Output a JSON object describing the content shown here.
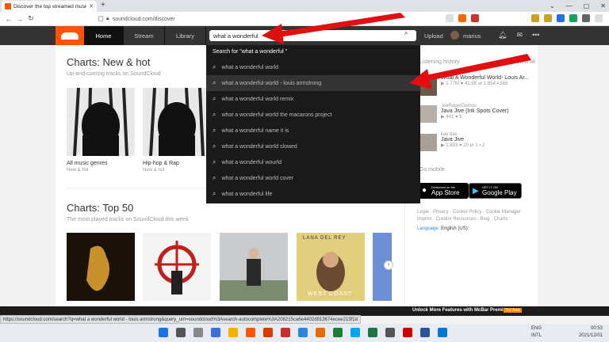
{
  "browser": {
    "tab_title": "Discover the top streamed music",
    "url": "soundcloud.com/discover",
    "status_url": "https://soundcloud.com/search?q=what a wonderful world - louis armstrong&query_urn=soundcloud%3Asearch-autocomplete%3A208215ca6e4402d913674ecee213f1d"
  },
  "header": {
    "nav": [
      "Home",
      "Stream",
      "Library"
    ],
    "search_value": "what a wonderful",
    "upload": "Upload",
    "username": "marius"
  },
  "charts_new": {
    "title": "Charts: New & hot",
    "subtitle": "Up-and-coming tracks on SoundCloud",
    "tiles": [
      {
        "label": "All music genres",
        "sub": "New & hot"
      },
      {
        "label": "Hip-hop & Rap",
        "sub": "New & hot"
      }
    ]
  },
  "charts_top": {
    "title": "Charts: Top 50",
    "subtitle": "The most played tracks on SoundCloud this week",
    "album_text": "LANA DEL REY",
    "album_text2": "WEST COAST"
  },
  "dropdown": {
    "header": "Search for \"what a wonderful \"",
    "items": [
      "what a wonderful world",
      "what a wonderful world - louis armstrong",
      "what a wonderful world remix",
      "what a wonderful world the macarons project",
      "what a wonderful name it is",
      "what a wonderful world slowed",
      "what a wonderful wourld",
      "what a wonderful world cover",
      "what a wonderful life"
    ]
  },
  "sidebar": {
    "history_label": "Listening history",
    "view_all": "View all",
    "tracks": [
      {
        "user": "",
        "title": "What A Wonderful World- Louis Ar...",
        "stats": "▶ 1.77M  ♥ 41.5K  ⇄ 1,854  ▪ 569"
      },
      {
        "user": "JoeRaperDemos",
        "title": "Java Jive (Ink Spots Cover)",
        "stats": "▶ 441  ♥ 5"
      },
      {
        "user": "kay das",
        "title": "Java Jive",
        "stats": "▶ 2,893  ♥ 20  ⇄ 1  ▪ 2"
      }
    ],
    "mobile_label": "Go mobile",
    "app_store": {
      "small": "Download on the",
      "big": "App Store"
    },
    "google_play": {
      "small": "GET IT ON",
      "big": "Google Play"
    },
    "legal": "Legal · Privacy · Cookie Policy · Cookie Manager · Imprint · Creator Resources · Blog · Charts ·",
    "language_label": "Language:",
    "language_value": "English (US)"
  },
  "mcbar": {
    "promo": "Unlock More Features with McBar Premium",
    "try": "Try free"
  },
  "taskbar": {
    "lang1": "ENG",
    "lang2": "INTL",
    "time": "00:53",
    "date": "2021/12/01"
  },
  "colors": {
    "accent": "#ff5500",
    "arrow": "#e01010"
  }
}
